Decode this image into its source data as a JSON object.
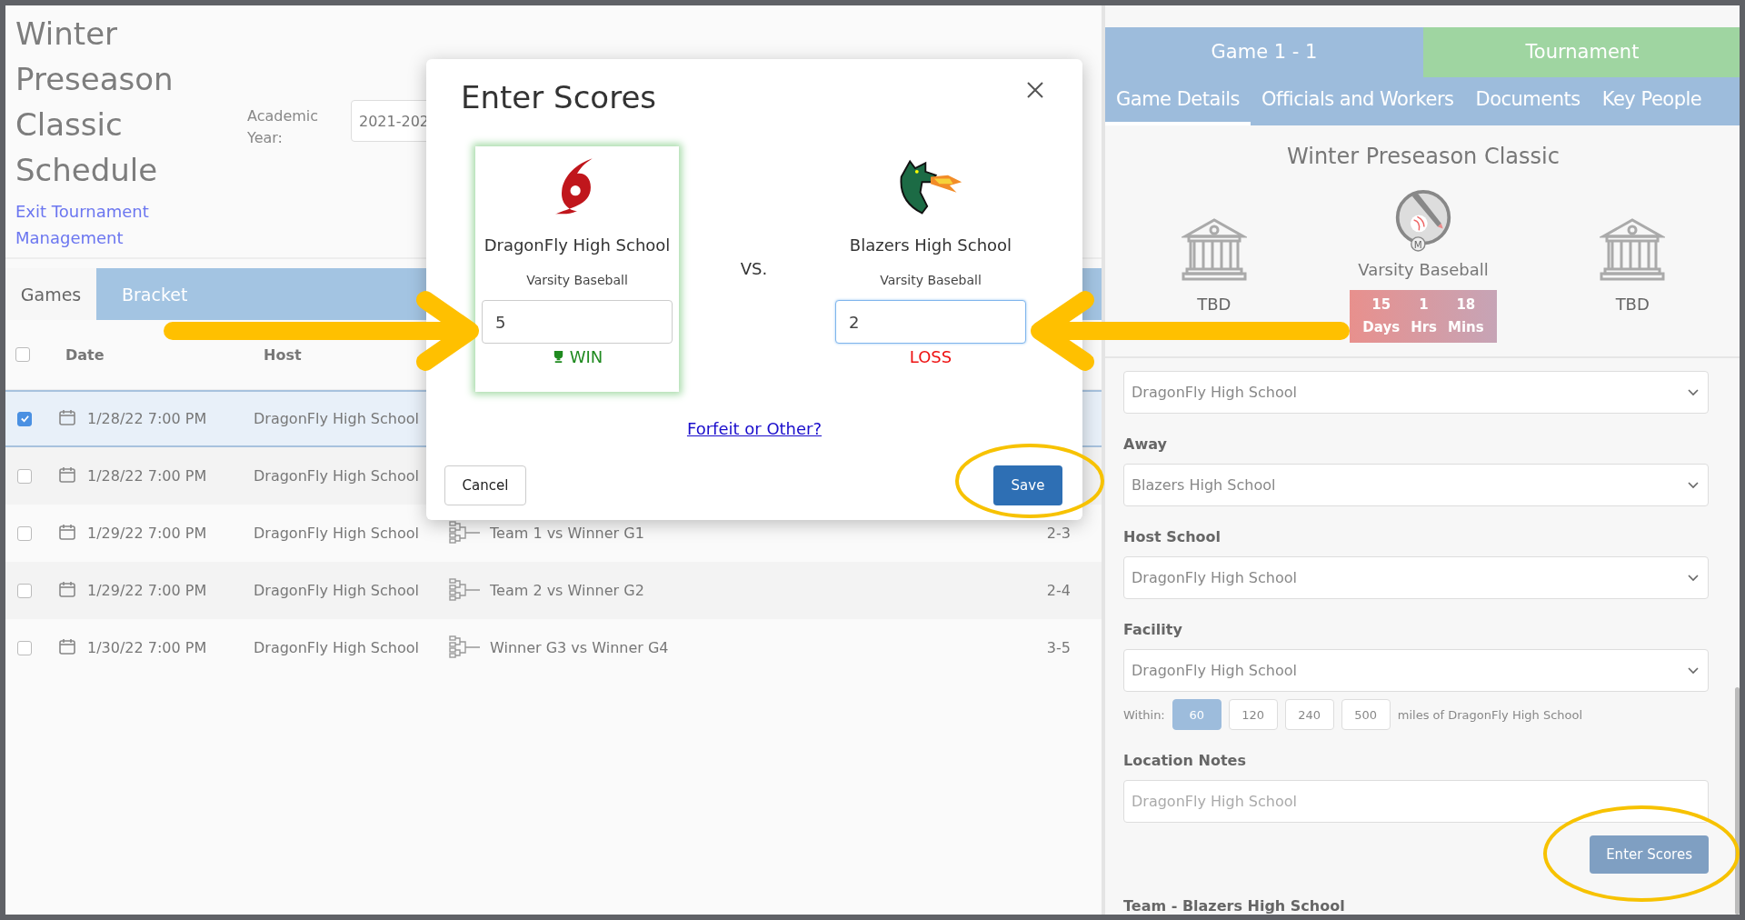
{
  "page": {
    "title": "Winter Preseason Classic Schedule",
    "exit_link": "Exit Tournament Management",
    "academic_year": {
      "label": "Academic Year:",
      "value": "2021-202"
    }
  },
  "tabs": [
    {
      "label": "Games",
      "selected": true
    },
    {
      "label": "Bracket",
      "selected": false
    }
  ],
  "table": {
    "columns": [
      "Date",
      "Host"
    ],
    "header_checked": false,
    "rows": [
      {
        "checked": true,
        "selected": true,
        "date": "1/28/22 7:00 PM",
        "host": "DragonFly High School"
      },
      {
        "checked": false,
        "selected": false,
        "date": "1/28/22 7:00 PM",
        "host": "DragonFly High School"
      },
      {
        "checked": false,
        "selected": false,
        "date": "1/29/22 7:00 PM",
        "host": "DragonFly High School",
        "game": "Team 1 vs Winner G1",
        "score": "2-3"
      },
      {
        "checked": false,
        "selected": false,
        "date": "1/29/22 7:00 PM",
        "host": "DragonFly High School",
        "game": "Team 2 vs Winner G2",
        "score": "2-4"
      },
      {
        "checked": false,
        "selected": false,
        "date": "1/30/22 7:00 PM",
        "host": "DragonFly High School",
        "game": "Winner G3 vs Winner G4",
        "score": "3-5"
      }
    ]
  },
  "modal": {
    "title": "Enter Scores",
    "vs": "VS.",
    "teams": [
      {
        "name": "DragonFly High School",
        "division": "Varsity Baseball",
        "score": "5",
        "result": "WIN",
        "kind": "win",
        "focused": false
      },
      {
        "name": "Blazers High School",
        "division": "Varsity Baseball",
        "score": "2",
        "result": "LOSS",
        "kind": "loss",
        "focused": true
      }
    ],
    "link": "Forfeit or Other?",
    "cancel": "Cancel",
    "save": "Save"
  },
  "detail": {
    "header_tabs": [
      {
        "label": "Game 1 - 1",
        "color": "#9dbcdc"
      },
      {
        "label": "Tournament",
        "color": "#9fd5a1"
      }
    ],
    "tabs": [
      {
        "label": "Game Details",
        "selected": true
      },
      {
        "label": "Officials and Workers",
        "selected": false
      },
      {
        "label": "Documents",
        "selected": false
      },
      {
        "label": "Key People",
        "selected": false
      }
    ],
    "event_title": "Winter Preseason Classic",
    "home": "TBD",
    "away": "TBD",
    "sport": "Varsity Baseball",
    "sport_badge": "M",
    "countdown": [
      {
        "value": "15",
        "unit": "Days"
      },
      {
        "value": "1",
        "unit": "Hrs"
      },
      {
        "value": "18",
        "unit": "Mins"
      }
    ],
    "fields": [
      {
        "kind": "select",
        "value": "DragonFly High School"
      },
      {
        "kind": "select",
        "label": "Away",
        "value": "Blazers High School"
      },
      {
        "kind": "select",
        "label": "Host School",
        "value": "DragonFly High School"
      },
      {
        "kind": "select",
        "label": "Facility",
        "value": "DragonFly High School"
      },
      {
        "kind": "radius",
        "label": "Within:",
        "options": [
          {
            "label": "60",
            "selected": true
          },
          {
            "label": "120",
            "selected": false
          },
          {
            "label": "240",
            "selected": false
          },
          {
            "label": "500",
            "selected": false
          }
        ],
        "suffix": "miles of DragonFly High School"
      },
      {
        "kind": "text",
        "label": "Location Notes",
        "value": "DragonFly High School"
      }
    ],
    "action": "Enter Scores",
    "section_title": "Team - Blazers High School"
  }
}
